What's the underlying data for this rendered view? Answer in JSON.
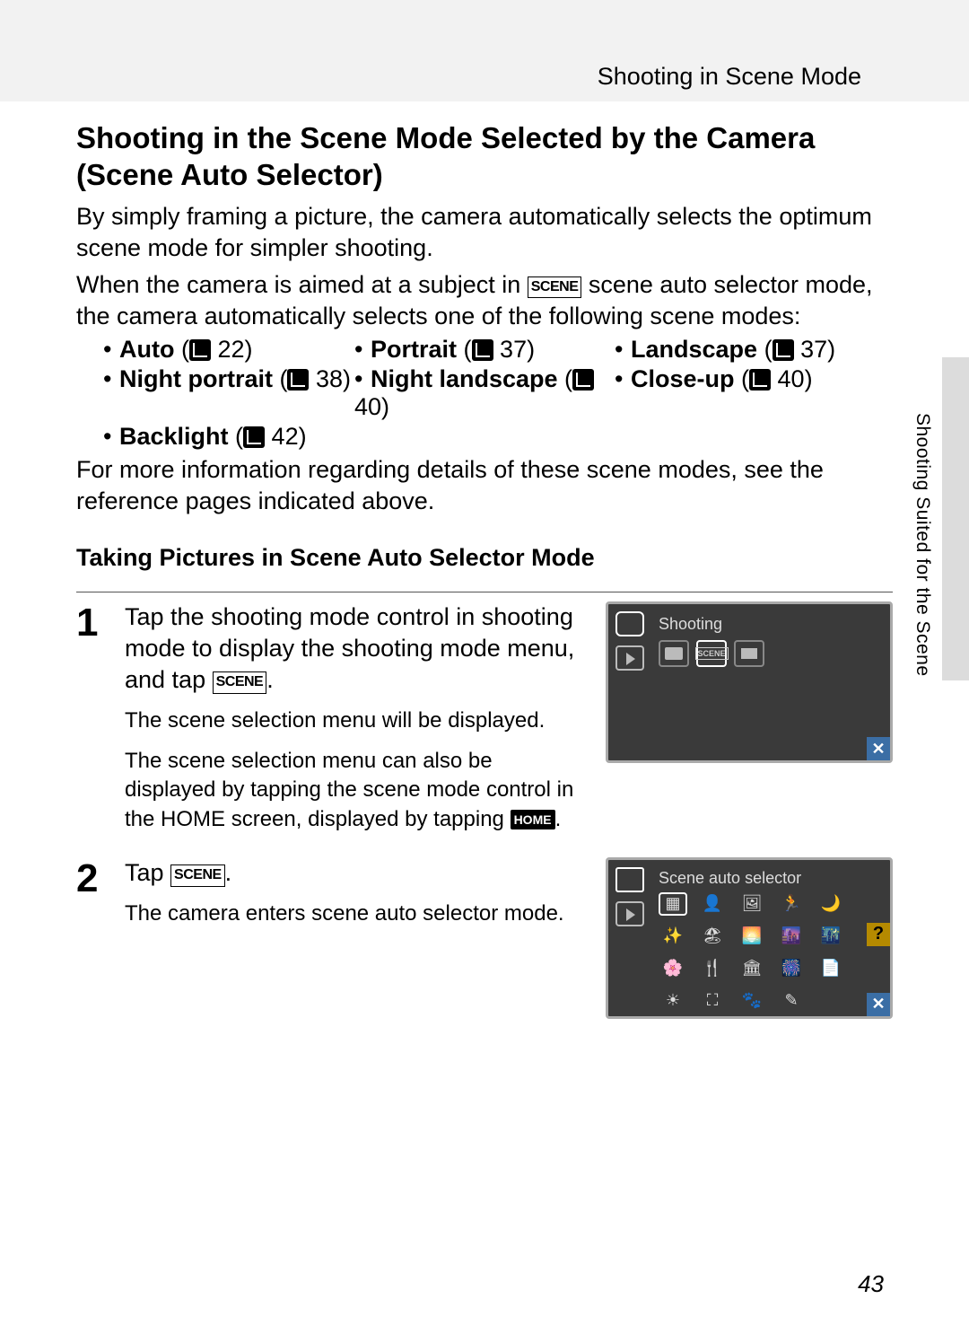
{
  "header": {
    "section": "Shooting in Scene Mode"
  },
  "title": "Shooting in the Scene Mode Selected by the Camera (Scene Auto Selector)",
  "intro1": "By simply framing a picture, the camera automatically selects the optimum scene mode for simpler shooting.",
  "intro2a": "When the camera is aimed at a subject in ",
  "intro2b": " scene auto selector mode, the camera automatically selects one of the following scene modes:",
  "scenes": {
    "auto": {
      "label": "Auto",
      "page": "22"
    },
    "portrait": {
      "label": "Portrait",
      "page": "37"
    },
    "landscape": {
      "label": "Landscape",
      "page": "37"
    },
    "night_portrait": {
      "label": "Night portrait",
      "page": "38"
    },
    "night_landscape": {
      "label": "Night landscape",
      "page": "40"
    },
    "closeup": {
      "label": "Close-up",
      "page": "40"
    },
    "backlight": {
      "label": "Backlight",
      "page": "42"
    }
  },
  "after_list": "For more information regarding details of these scene modes, see the reference pages indicated above.",
  "subhead": "Taking Pictures in Scene Auto Selector Mode",
  "step1": {
    "num": "1",
    "main_a": "Tap the shooting mode control in shooting mode to display the shooting mode menu, and tap ",
    "main_b": ".",
    "sub1": "The scene selection menu will be displayed.",
    "sub2_a": "The scene selection menu can also be displayed by tapping the scene mode control in the HOME screen, displayed by tapping ",
    "sub2_b": "."
  },
  "lcd1": {
    "title": "Shooting"
  },
  "step2": {
    "num": "2",
    "main_a": "Tap ",
    "main_b": ".",
    "sub1": "The camera enters scene auto selector mode."
  },
  "lcd2": {
    "title": "Scene auto selector",
    "help": "?",
    "close": "✕"
  },
  "sidebar": "Shooting Suited for the Scene",
  "page_number": "43",
  "icons": {
    "scene": "SCENE",
    "scene_auto": "SCENE",
    "home": "HOME"
  }
}
